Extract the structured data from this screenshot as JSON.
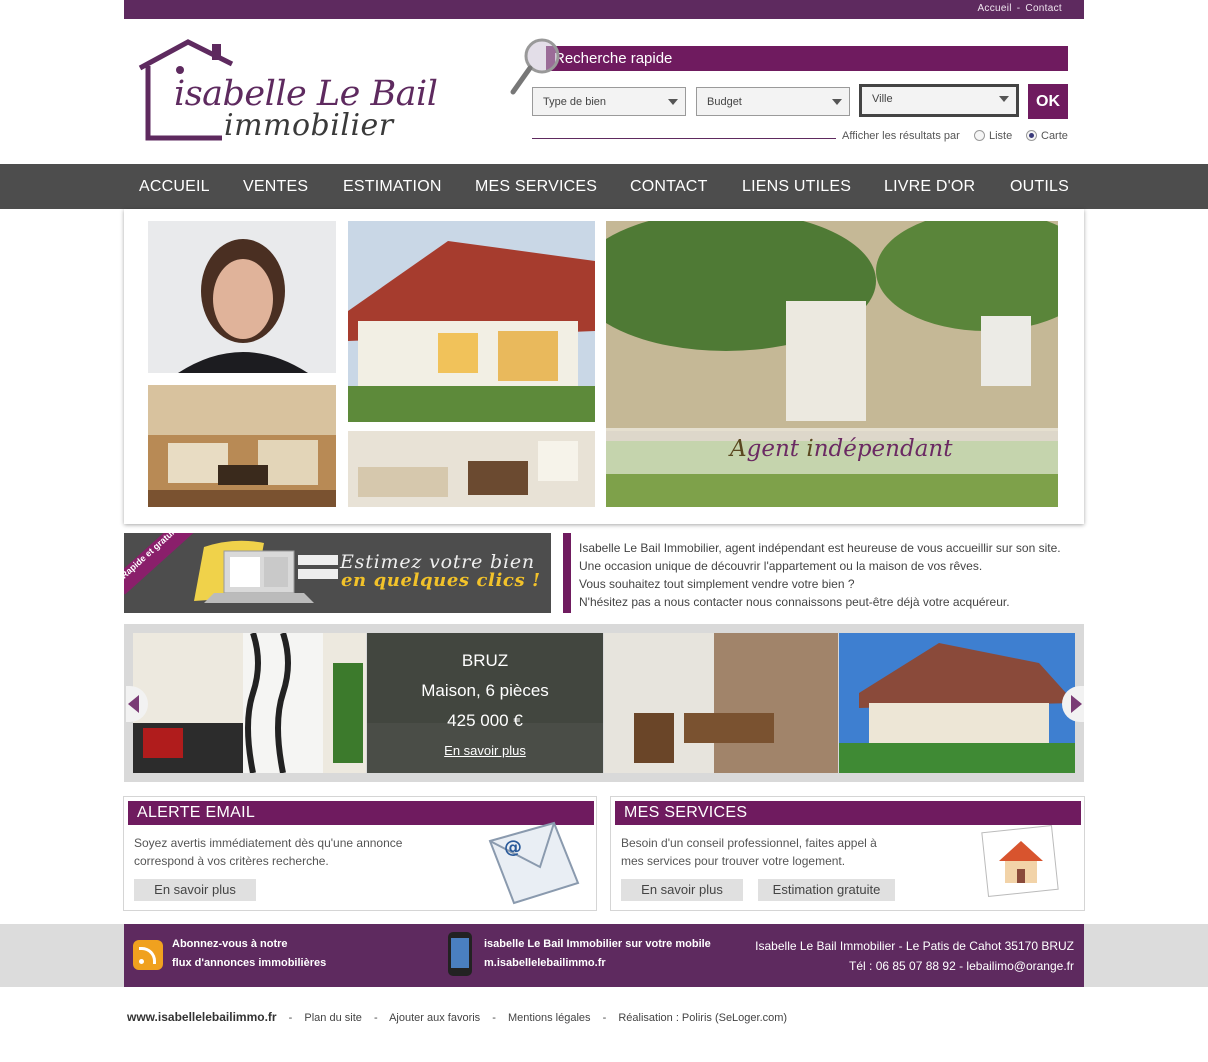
{
  "toplinks": {
    "home": "Accueil",
    "sep": "-",
    "contact": "Contact"
  },
  "logo": {
    "line1": "isabelle Le Bail",
    "line2": "immobilier"
  },
  "search": {
    "title": "Recherche rapide",
    "type_label": "Type de bien",
    "budget_label": "Budget",
    "city_label": "Ville",
    "ok_label": "OK",
    "results_label": "Afficher les résultats par",
    "option_list": "Liste",
    "option_map": "Carte",
    "selected_option": "Carte"
  },
  "nav": [
    "ACCUEIL",
    "VENTES",
    "ESTIMATION",
    "MES SERVICES",
    "CONTACT",
    "LIENS UTILES",
    "LIVRE D'OR",
    "OUTILS"
  ],
  "gallery": {
    "caption_a": "A",
    "caption_rest1": "gent ",
    "caption_i": "i",
    "caption_rest2": "ndépendant"
  },
  "estimate_banner": {
    "badge": "Rapide et gratuit !",
    "line1": "Estimez votre bien",
    "line2": "en quelques clics !"
  },
  "intro": [
    "Isabelle Le Bail Immobilier, agent indépendant est heureuse de vous accueillir sur son site.",
    "Une occasion unique de découvrir l'appartement ou la maison de vos rêves.",
    "Vous souhaitez tout simplement vendre votre bien ?",
    "N'hésitez pas a nous contacter nous connaissons peut-être déjà votre acquéreur."
  ],
  "featured": {
    "city": "BRUZ",
    "type": "Maison, 6 pièces",
    "price": "425 000 €",
    "more": "En savoir plus"
  },
  "alert_box": {
    "title": "ALERTE EMAIL",
    "text1": "Soyez avertis immédiatement dès qu'une annonce",
    "text2": "correspond à vos critères recherche.",
    "button": "En savoir plus"
  },
  "services_box": {
    "title": "MES SERVICES",
    "text1": "Besoin d'un conseil professionnel, faites appel à",
    "text2": "mes services pour trouver votre logement.",
    "button1": "En savoir plus",
    "button2": "Estimation gratuite"
  },
  "footer": {
    "rss1": "Abonnez-vous à notre",
    "rss2": "flux d'annonces immobilières",
    "mobile1": "isabelle Le Bail Immobilier sur votre mobile",
    "mobile2": "m.isabellelebailimmo.fr",
    "address": "Isabelle Le Bail Immobilier - Le Patis de Cahot 35170 BRUZ",
    "contact": "Tél : 06 85 07 88 92 - lebailimo@orange.fr"
  },
  "bottom": {
    "site": "www.isabellelebailimmo.fr",
    "sep": "-",
    "plan": "Plan du site",
    "fav": "Ajouter aux favoris",
    "legal": "Mentions légales",
    "credit": "Réalisation : Poliris (SeLoger.com)"
  },
  "colors": {
    "brand": "#6f1b5f",
    "topbar": "#5e2a5f",
    "nav": "#4d4d4d"
  }
}
